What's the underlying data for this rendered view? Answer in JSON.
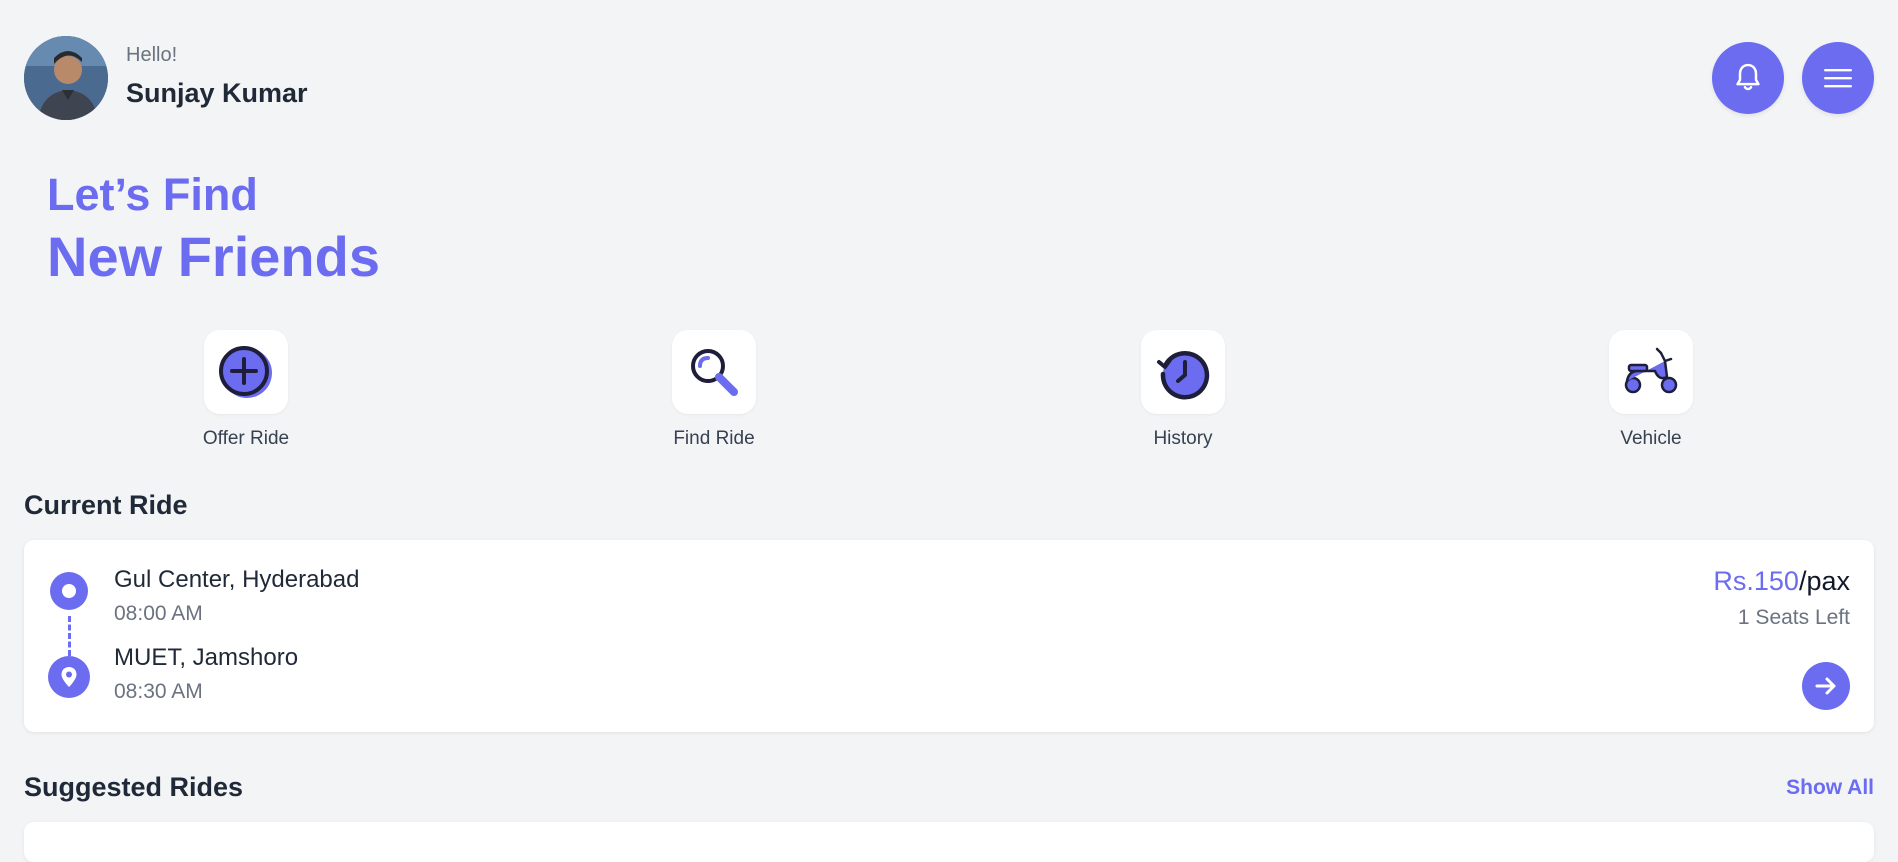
{
  "header": {
    "greeting": "Hello!",
    "username": "Sunjay Kumar",
    "avatar_icon": "user-avatar-photo",
    "notification_icon": "bell-icon",
    "menu_icon": "hamburger-menu-icon"
  },
  "hero": {
    "line1": "Let’s Find",
    "line2": "New Friends"
  },
  "quick_actions": [
    {
      "label": "Offer Ride",
      "icon": "plus-circle-icon"
    },
    {
      "label": "Find Ride",
      "icon": "magnifier-icon"
    },
    {
      "label": "History",
      "icon": "history-clock-icon"
    },
    {
      "label": "Vehicle",
      "icon": "scooter-icon"
    }
  ],
  "current_ride": {
    "title": "Current Ride",
    "from": {
      "place": "Gul Center, Hyderabad",
      "time": "08:00 AM"
    },
    "to": {
      "place": "MUET, Jamshoro",
      "time": "08:30 AM"
    },
    "price": "Rs.150",
    "price_unit": "/pax",
    "seats": "1 Seats Left",
    "go_icon": "arrow-right-icon"
  },
  "suggested": {
    "title": "Suggested Rides",
    "show_all": "Show All"
  },
  "colors": {
    "accent": "#6c6cf0",
    "background": "#f3f4f6",
    "card": "#ffffff",
    "text_dark": "#1f2937",
    "text_muted": "#6b7280"
  }
}
